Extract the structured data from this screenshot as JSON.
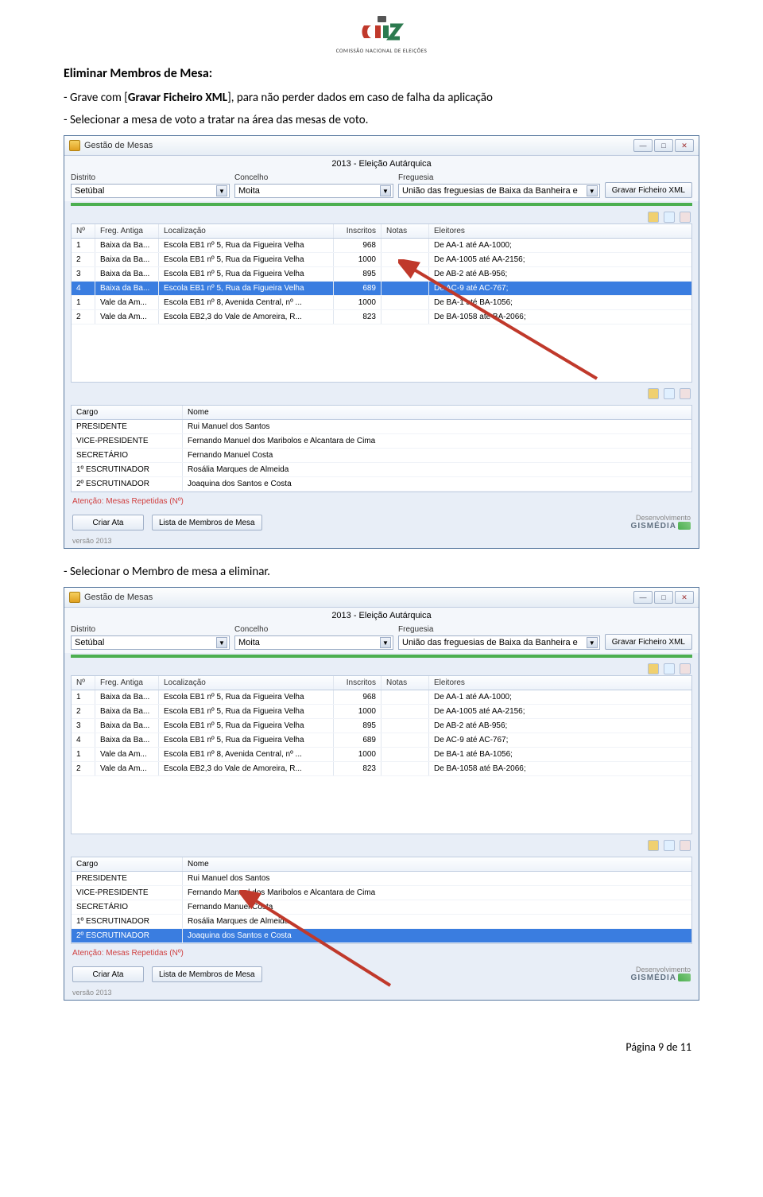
{
  "logo_subtitle": "COMISSÃO NACIONAL DE ELEIÇÕES",
  "section_title": "Eliminar Membros de Mesa:",
  "instr1_pre": "- Grave com [",
  "instr1_bold": "Gravar Ficheiro XML",
  "instr1_post": "], para não perder dados em caso de falha da aplicação",
  "instr2": "- Selecionar a mesa de voto a tratar na área das mesas de voto.",
  "instr3": "- Selecionar o Membro de mesa a eliminar.",
  "app": {
    "title": "Gestão de Mesas",
    "election": "2013 - Eleição Autárquica",
    "labels": {
      "distrito": "Distrito",
      "concelho": "Concelho",
      "freguesia": "Freguesia"
    },
    "values": {
      "distrito": "Setúbal",
      "concelho": "Moita",
      "freguesia": "União das freguesias de Baixa da Banheira e"
    },
    "save_btn": "Gravar Ficheiro XML",
    "table_headers": {
      "n": "Nº",
      "fa": "Freg. Antiga",
      "loc": "Localização",
      "ins": "Inscritos",
      "not": "Notas",
      "el": "Eleitores"
    },
    "rows": [
      {
        "n": "1",
        "fa": "Baixa da Ba...",
        "loc": "Escola EB1 nº 5, Rua da Figueira Velha",
        "ins": "968",
        "el": "De AA-1 até AA-1000;"
      },
      {
        "n": "2",
        "fa": "Baixa da Ba...",
        "loc": "Escola EB1 nº 5, Rua da Figueira Velha",
        "ins": "1000",
        "el": "De AA-1005 até AA-2156;"
      },
      {
        "n": "3",
        "fa": "Baixa da Ba...",
        "loc": "Escola EB1 nº 5, Rua da Figueira Velha",
        "ins": "895",
        "el": "De AB-2 até AB-956;"
      },
      {
        "n": "4",
        "fa": "Baixa da Ba...",
        "loc": "Escola EB1 nº 5, Rua da Figueira Velha",
        "ins": "689",
        "el": "De AC-9 até AC-767;"
      },
      {
        "n": "1",
        "fa": "Vale da Am...",
        "loc": "Escola EB1 nº 8, Avenida Central, nº ...",
        "ins": "1000",
        "el": "De BA-1 até BA-1056;"
      },
      {
        "n": "2",
        "fa": "Vale da Am...",
        "loc": "Escola EB2,3 do Vale de Amoreira, R...",
        "ins": "823",
        "el": "De BA-1058 até BA-2066;"
      }
    ],
    "selected_row_index_window1": 3,
    "members_headers": {
      "cargo": "Cargo",
      "nome": "Nome"
    },
    "members": [
      {
        "cargo": "PRESIDENTE",
        "nome": "Rui Manuel dos Santos"
      },
      {
        "cargo": "VICE-PRESIDENTE",
        "nome": "Fernando Manuel dos Maribolos e Alcantara de Cima"
      },
      {
        "cargo": "SECRETÁRIO",
        "nome": "Fernando Manuel Costa"
      },
      {
        "cargo": "1º ESCRUTINADOR",
        "nome": "Rosália Marques de Almeida"
      },
      {
        "cargo": "2º ESCRUTINADOR",
        "nome": "Joaquina dos Santos  e Costa"
      }
    ],
    "selected_member_index_window2": 4,
    "warning": "Atenção: Mesas Repetidas (Nº)",
    "btn_criar": "Criar Ata",
    "btn_lista": "Lista de Membros de Mesa",
    "dev_label": "Desenvolvimento",
    "brand": "GISMÉDIA",
    "version": "versão 2013"
  },
  "footer": "Página 9 de 11"
}
